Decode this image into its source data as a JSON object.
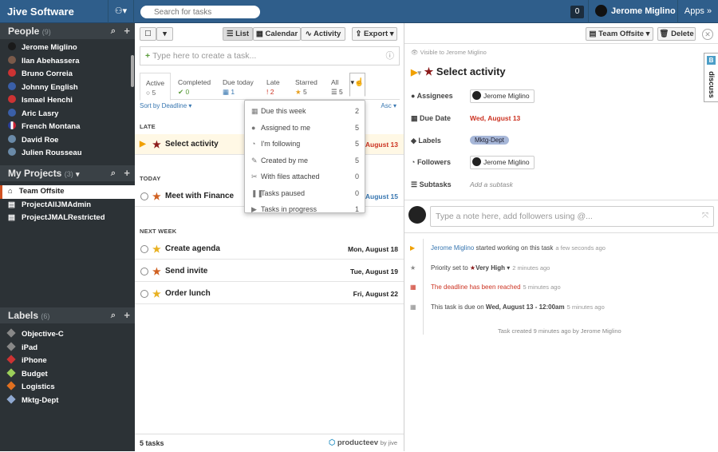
{
  "topbar": {
    "brand": "Jive Software",
    "search_placeholder": "Search for tasks",
    "notifications": "0",
    "user_name": "Jerome Miglino",
    "apps_label": "Apps"
  },
  "sidebar": {
    "people_title": "People",
    "people_count": "(9)",
    "people": [
      {
        "name": "Jerome Miglino",
        "color": "#1a1a1a"
      },
      {
        "name": "Ilan Abehassera",
        "color": "#7a5a4a"
      },
      {
        "name": "Bruno Correia",
        "color": "#cc3333"
      },
      {
        "name": "Johnny English",
        "color": "#3a5fa8"
      },
      {
        "name": "Ismael Henchi",
        "color": "#cc3333"
      },
      {
        "name": "Aric Lasry",
        "color": "#3a5fa8"
      },
      {
        "name": "French Montana",
        "color": "#d8d8f0"
      },
      {
        "name": "David Roe",
        "color": "#6a8aa8"
      },
      {
        "name": "Julien Rousseau",
        "color": "#6a8aa8"
      }
    ],
    "projects_title": "My Projects",
    "projects_count": "(3)",
    "projects": [
      {
        "name": "Team Offsite",
        "active": true
      },
      {
        "name": "ProjectAllJMAdmin",
        "active": false
      },
      {
        "name": "ProjectJMALRestricted",
        "active": false
      }
    ],
    "labels_title": "Labels",
    "labels_count": "(6)",
    "labels": [
      {
        "name": "Objective-C",
        "color": "#888888"
      },
      {
        "name": "iPad",
        "color": "#888888"
      },
      {
        "name": "iPhone",
        "color": "#cc3333"
      },
      {
        "name": "Budget",
        "color": "#9bcf5a"
      },
      {
        "name": "Logistics",
        "color": "#e07020"
      },
      {
        "name": "Mktg-Dept",
        "color": "#8fa8d0"
      }
    ]
  },
  "toolbar": {
    "list": "List",
    "calendar": "Calendar",
    "activity": "Activity",
    "export": "Export"
  },
  "new_task_placeholder": "Type here to create a task...",
  "filters": [
    {
      "label": "Active",
      "value": "5",
      "icon": "○"
    },
    {
      "label": "Completed",
      "value": "0",
      "icon": "✔"
    },
    {
      "label": "Due today",
      "value": "1",
      "icon": "▦"
    },
    {
      "label": "Late",
      "value": "2",
      "icon": "!"
    },
    {
      "label": "Starred",
      "value": "5",
      "icon": "★"
    },
    {
      "label": "All",
      "value": "5",
      "icon": "☰"
    }
  ],
  "sort": {
    "label": "Sort by Deadline",
    "order": "Asc"
  },
  "groups": {
    "late": "LATE",
    "today": "TODAY",
    "next_week": "NEXT WEEK"
  },
  "tasks": [
    {
      "title": "Select activity",
      "due": "Wed, August 13",
      "star": "#8b1a1a",
      "due_color": "#cc3322"
    },
    {
      "title": "Meet with Finance",
      "due": "Fri, August 15",
      "star": "#d06020",
      "due_color": "#3776b0"
    },
    {
      "title": "Create agenda",
      "due": "Mon, August 18",
      "star": "#e8b020",
      "due_color": "#333333"
    },
    {
      "title": "Send invite",
      "due": "Tue, August 19",
      "star": "#d06020",
      "due_color": "#333333"
    },
    {
      "title": "Order lunch",
      "due": "Fri, August 22",
      "star": "#e8b020",
      "due_color": "#333333"
    }
  ],
  "footer": {
    "count": "5 tasks",
    "logo": "producteev",
    "by": "by jive"
  },
  "dropdown": [
    {
      "label": "Due this week",
      "count": "2",
      "icon": "▦"
    },
    {
      "label": "Assigned to me",
      "count": "5",
      "icon": "●"
    },
    {
      "label": "I'm following",
      "count": "5",
      "icon": "◔"
    },
    {
      "label": "Created by me",
      "count": "5",
      "icon": "✎"
    },
    {
      "label": "With files attached",
      "count": "0",
      "icon": "✂"
    },
    {
      "label": "Tasks paused",
      "count": "0",
      "icon": "❚❚"
    },
    {
      "label": "Tasks in progress",
      "count": "1",
      "icon": "▶"
    }
  ],
  "detail": {
    "project": "Team Offsite",
    "delete": "Delete",
    "visibility": "Visible to Jerome Miglino",
    "title": "Select activity",
    "assignees_label": "Assignees",
    "assignee": "Jerome Miglino",
    "due_label": "Due Date",
    "due": "Wed, August 13",
    "labels_label": "Labels",
    "label": "Mktg-Dept",
    "followers_label": "Followers",
    "follower": "Jerome Miglino",
    "subtasks_label": "Subtasks",
    "subtask_placeholder": "Add a subtask",
    "note_placeholder": "Type a note here, add followers using @...",
    "discuss": "discuss"
  },
  "activity": [
    {
      "name": "Jerome Miglino",
      "text": " started working on this task",
      "ago": "a few seconds ago"
    },
    {
      "text": "Priority set to ",
      "strong": "Very High",
      "ago": "2 minutes ago"
    },
    {
      "text": "The deadline has been reached",
      "ago": "5 minutes ago"
    },
    {
      "text": "This task is due on ",
      "strong": "Wed, August 13 - 12:00am",
      "ago": "5 minutes ago"
    }
  ],
  "created_text": "Task created 9 minutes ago by Jerome Miglino"
}
